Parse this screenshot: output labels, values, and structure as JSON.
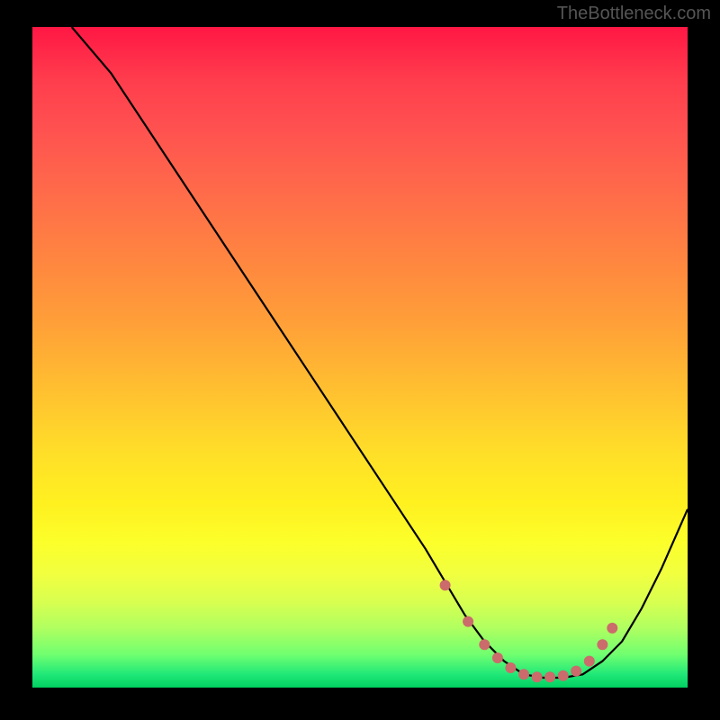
{
  "attribution": "TheBottleneck.com",
  "chart_data": {
    "type": "line",
    "title": "",
    "xlabel": "",
    "ylabel": "",
    "xlim": [
      0,
      100
    ],
    "ylim": [
      0,
      100
    ],
    "series": [
      {
        "name": "curve",
        "x": [
          6,
          12,
          18,
          24,
          30,
          36,
          42,
          48,
          54,
          60,
          63,
          66,
          69,
          72,
          75,
          78,
          81,
          84,
          87,
          90,
          93,
          96,
          100
        ],
        "y": [
          100,
          93,
          84,
          75,
          66,
          57,
          48,
          39,
          30,
          21,
          16,
          11,
          7,
          4,
          2,
          1.5,
          1.5,
          2,
          4,
          7,
          12,
          18,
          27
        ]
      }
    ],
    "markers": {
      "name": "highlight-dots",
      "color": "#cc6b6b",
      "x": [
        63,
        66.5,
        69,
        71,
        73,
        75,
        77,
        79,
        81,
        83,
        85,
        87,
        88.5
      ],
      "y": [
        15.5,
        10,
        6.5,
        4.5,
        3,
        2,
        1.6,
        1.6,
        1.8,
        2.5,
        4,
        6.5,
        9
      ]
    },
    "background_gradient": {
      "direction": "vertical",
      "stops": [
        {
          "pos": 0,
          "color": "#ff1744"
        },
        {
          "pos": 50,
          "color": "#ffc030"
        },
        {
          "pos": 80,
          "color": "#fcff2a"
        },
        {
          "pos": 100,
          "color": "#00d060"
        }
      ]
    }
  }
}
